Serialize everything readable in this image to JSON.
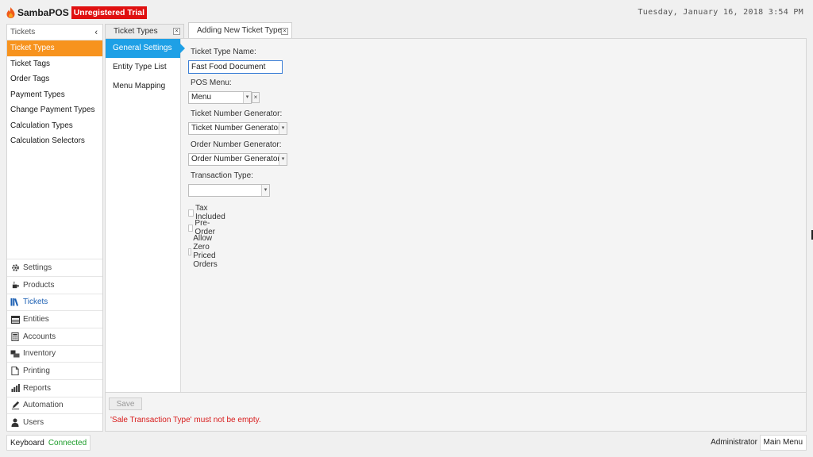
{
  "app": {
    "brand": "SambaPOS",
    "trial_badge": "Unregistered Trial",
    "datetime": "Tuesday, January 16, 2018 3:54 PM"
  },
  "leftnav": {
    "header": "Tickets",
    "collapse_glyph": "‹",
    "items": [
      {
        "label": "Ticket Types",
        "active": true
      },
      {
        "label": "Ticket Tags"
      },
      {
        "label": "Order Tags"
      },
      {
        "label": "Payment Types"
      },
      {
        "label": "Change Payment Types"
      },
      {
        "label": "Calculation Types"
      },
      {
        "label": "Calculation Selectors"
      }
    ],
    "modules": [
      {
        "label": "Settings",
        "icon": "gear-icon"
      },
      {
        "label": "Products",
        "icon": "coffee-icon"
      },
      {
        "label": "Tickets",
        "icon": "books-icon",
        "active": true
      },
      {
        "label": "Entities",
        "icon": "table-icon"
      },
      {
        "label": "Accounts",
        "icon": "calculator-icon"
      },
      {
        "label": "Inventory",
        "icon": "boxes-icon"
      },
      {
        "label": "Printing",
        "icon": "document-icon"
      },
      {
        "label": "Reports",
        "icon": "bar-chart-icon"
      },
      {
        "label": "Automation",
        "icon": "pencil-icon"
      },
      {
        "label": "Users",
        "icon": "user-icon"
      }
    ]
  },
  "tabs": [
    {
      "label": "Ticket Types",
      "close": "×"
    },
    {
      "label": "Adding New Ticket Type",
      "close": "×",
      "active": true
    }
  ],
  "sidemenu": [
    {
      "label": "General Settings",
      "active": true
    },
    {
      "label": "Entity Type List"
    },
    {
      "label": "Menu Mapping"
    }
  ],
  "form": {
    "ticket_type_name_label": "Ticket Type Name:",
    "ticket_type_name_value": "Fast Food Document",
    "pos_menu_label": "POS Menu:",
    "pos_menu_value": "Menu",
    "pos_menu_clear": "×",
    "ticket_number_generator_label": "Ticket Number Generator:",
    "ticket_number_generator_value": "Ticket Number Generator",
    "order_number_generator_label": "Order Number Generator:",
    "order_number_generator_value": "Order Number Generator",
    "transaction_type_label": "Transaction Type:",
    "transaction_type_value": "",
    "checkboxes": [
      {
        "label": "Tax Included",
        "checked": false
      },
      {
        "label": "Pre-Order",
        "checked": false
      },
      {
        "label": "Allow Zero Priced Orders",
        "checked": false
      }
    ],
    "dropdown_glyph": "▾"
  },
  "footer": {
    "save_label": "Save",
    "error": "'Sale Transaction Type' must not be empty."
  },
  "statusbar": {
    "keyboard": "Keyboard",
    "connection": "Connected",
    "user": "Administrator",
    "main_menu": "Main Menu"
  },
  "colors": {
    "accent_orange": "#f7931e",
    "accent_blue": "#1ea0e6",
    "trial_red": "#e01010",
    "error_red": "#d81b1b",
    "connected_green": "#1c9c2a"
  }
}
